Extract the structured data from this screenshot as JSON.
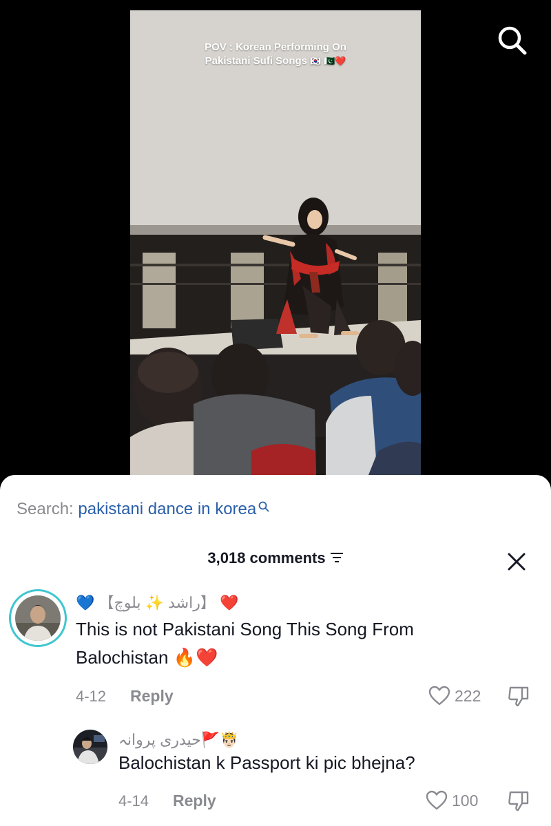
{
  "video": {
    "caption_line1": "POV : Korean Performing On",
    "caption_line2": "Pakistani Sufi Songs",
    "caption_emoji": "🇰🇷 🇵🇰❤️"
  },
  "top_bar": {
    "search_icon": "search-icon"
  },
  "search_suggestion": {
    "prefix": "Search:",
    "query": "pakistani dance in korea",
    "icon": "search-icon"
  },
  "comments_header": {
    "count_label": "3,018 comments",
    "sort_icon": "sort-icon",
    "close_icon": "close-icon"
  },
  "comments": [
    {
      "username": "💙 【راشد ✨ بلوچ】 ❤️",
      "text": "This is not Pakistani Song This Song From Balochistan 🔥❤️",
      "date": "4-12",
      "reply_label": "Reply",
      "likes": "222"
    },
    {
      "username": "حیدری پروانہ🚩🤴🏻",
      "text": "Balochistan k Passport ki pic bhejna?",
      "date": "4-14",
      "reply_label": "Reply",
      "likes": "100"
    }
  ],
  "colors": {
    "accent_link": "#2a5fa9",
    "muted_text": "#8a8b91",
    "primary_text": "#161823",
    "avatar_ring": "#3fc6cf"
  }
}
